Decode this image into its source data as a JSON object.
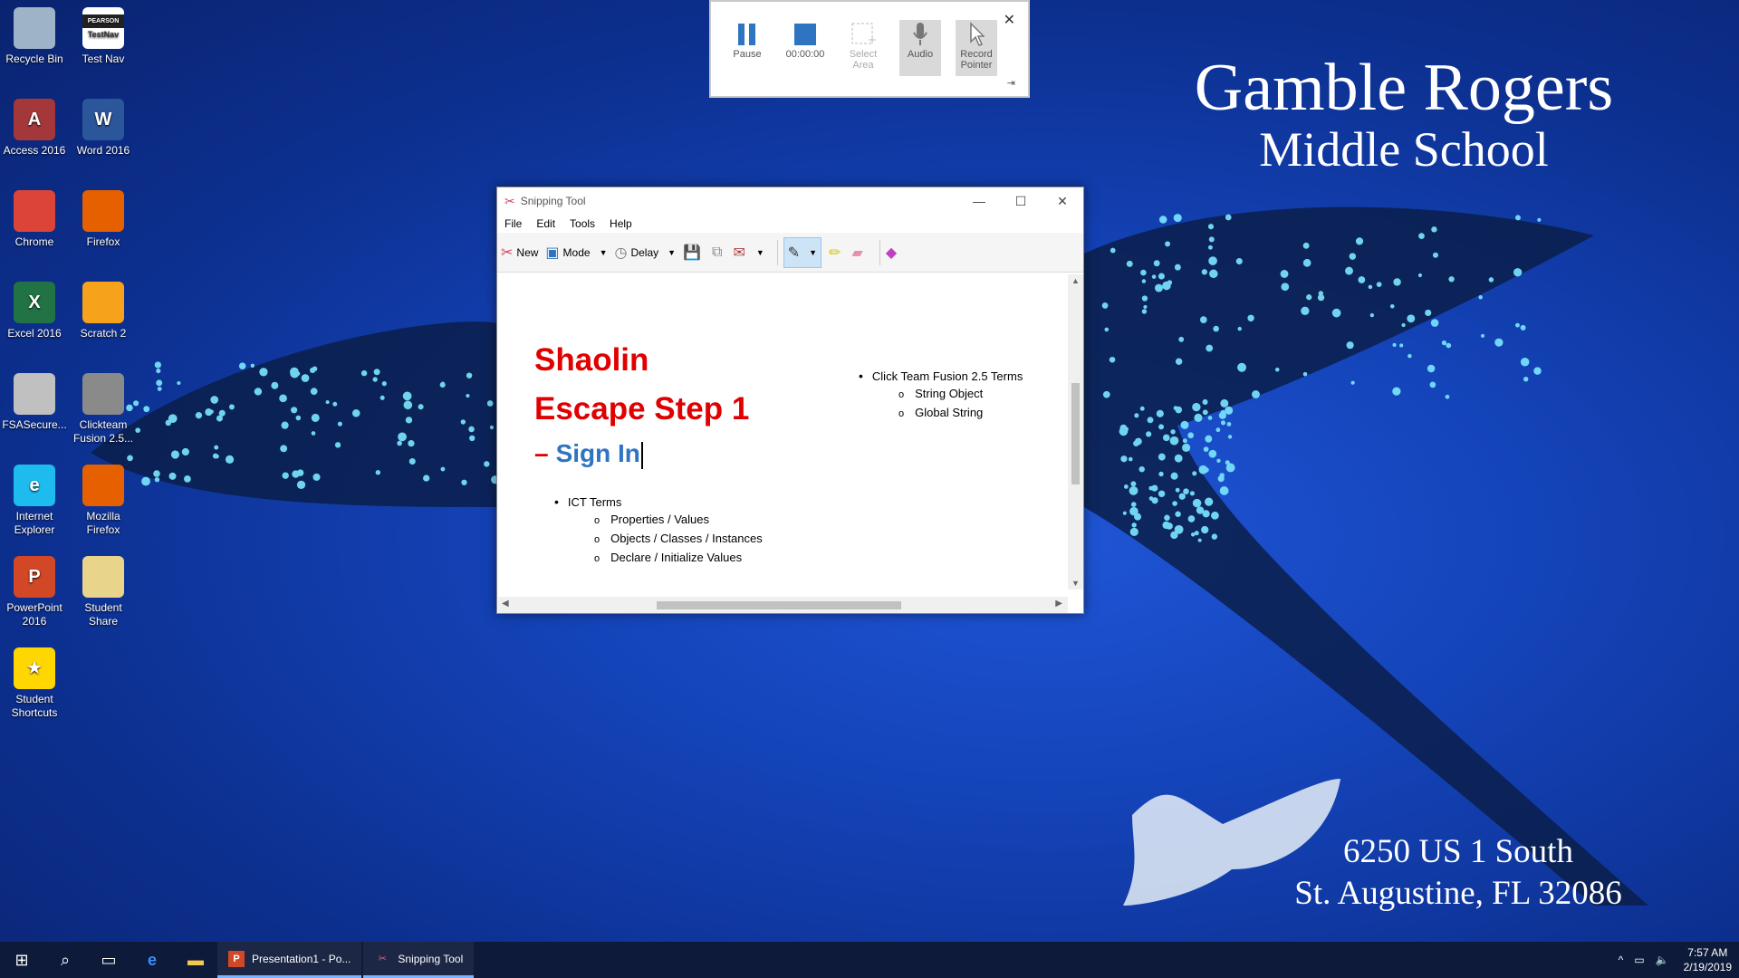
{
  "desktop": {
    "icons": [
      {
        "label": "Recycle Bin",
        "icon": "recycle-bin-icon",
        "color": "#9fb3c8"
      },
      {
        "label": "Test Nav",
        "icon": "testnav-icon",
        "color": "#ffffff",
        "badge": "PEARSON",
        "inner": "TestNav"
      },
      {
        "label": "Access 2016",
        "icon": "access-icon",
        "color": "#a4373a",
        "glyph": "A"
      },
      {
        "label": "Word 2016",
        "icon": "word-icon",
        "color": "#2b579a",
        "glyph": "W"
      },
      {
        "label": "Chrome",
        "icon": "chrome-icon",
        "color": "#db4437"
      },
      {
        "label": "Firefox",
        "icon": "firefox-icon",
        "color": "#e66000"
      },
      {
        "label": "Excel 2016",
        "icon": "excel-icon",
        "color": "#217346",
        "glyph": "X"
      },
      {
        "label": "Scratch 2",
        "icon": "scratch-icon",
        "color": "#f7a21b"
      },
      {
        "label": "FSASecure...",
        "icon": "fsa-secure-icon",
        "color": "#c0c0c0"
      },
      {
        "label": "Clickteam Fusion 2.5...",
        "icon": "clickteam-icon",
        "color": "#8a8a8a"
      },
      {
        "label": "Internet Explorer",
        "icon": "internet-explorer-icon",
        "color": "#1ebbee",
        "glyph": "e"
      },
      {
        "label": "Mozilla Firefox",
        "icon": "mozilla-firefox-icon",
        "color": "#e66000"
      },
      {
        "label": "PowerPoint 2016",
        "icon": "powerpoint-icon",
        "color": "#d24726",
        "glyph": "P"
      },
      {
        "label": "Student Share",
        "icon": "student-share-icon",
        "color": "#e8d48a"
      },
      {
        "label": "Student Shortcuts",
        "icon": "star-icon",
        "color": "#ffd700",
        "glyph": "★"
      }
    ]
  },
  "wallpaper": {
    "school_line1": "Gamble Rogers",
    "school_line2": "Middle School",
    "address_line1": "6250 US 1 South",
    "address_line2": "St. Augustine, FL 32086"
  },
  "recorder": {
    "pause": "Pause",
    "timer": "00:00:00",
    "select_area_line1": "Select",
    "select_area_line2": "Area",
    "audio": "Audio",
    "record_pointer_line1": "Record",
    "record_pointer_line2": "Pointer"
  },
  "snipping_tool": {
    "title": "Snipping Tool",
    "menu": [
      "File",
      "Edit",
      "Tools",
      "Help"
    ],
    "toolbar": {
      "new": "New",
      "mode": "Mode",
      "delay": "Delay"
    },
    "content": {
      "title_line1": "Shaolin",
      "title_line2": "Escape Step 1",
      "subtitle": "Sign In",
      "left_bullet": "ICT Terms",
      "left_sub": [
        "Properties / Values",
        "Objects / Classes / Instances",
        "Declare / Initialize Values"
      ],
      "right_bullet": "Click Team Fusion 2.5 Terms",
      "right_sub": [
        "String Object",
        "Global String"
      ]
    }
  },
  "taskbar": {
    "apps": [
      {
        "label": "Presentation1 - Po...",
        "icon": "powerpoint-icon"
      },
      {
        "label": "Snipping Tool",
        "icon": "snipping-tool-icon"
      }
    ],
    "time": "7:57 AM",
    "date": "2/19/2019"
  }
}
